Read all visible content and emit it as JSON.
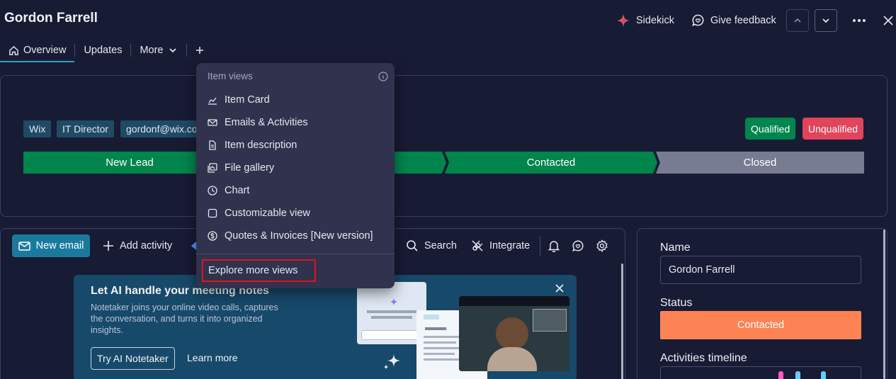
{
  "header": {
    "title": "Gordon Farrell",
    "sidekick_label": "Sidekick",
    "feedback_label": "Give feedback"
  },
  "tabs": [
    {
      "label": "Overview"
    },
    {
      "label": "Updates"
    },
    {
      "label": "More"
    }
  ],
  "tags": [
    "Wix",
    "IT Director",
    "gordonf@wix.co"
  ],
  "badges": {
    "qualified": "Qualified",
    "unqualified": "Unqualified"
  },
  "stages": [
    "New Lead",
    "Contacted",
    "Closed"
  ],
  "activity": {
    "new_email": "New email",
    "add_activity": "Add activity",
    "search": "Search",
    "integrate": "Integrate"
  },
  "banner": {
    "title": "Let AI handle your meeting notes",
    "description": "Notetaker joins your online video calls, captures the conversation, and turns it into organized insights.",
    "try_label": "Try AI Notetaker",
    "learn_label": "Learn more"
  },
  "details": {
    "name_label": "Name",
    "name_value": "Gordon Farrell",
    "status_label": "Status",
    "status_value": "Contacted",
    "timeline_label": "Activities timeline"
  },
  "menu": {
    "header": "Item views",
    "items": [
      {
        "label": "Item Card",
        "icon": "chart-card-icon"
      },
      {
        "label": "Emails & Activities",
        "icon": "mail-icon"
      },
      {
        "label": "Item description",
        "icon": "document-icon"
      },
      {
        "label": "File gallery",
        "icon": "gallery-icon"
      },
      {
        "label": "Chart",
        "icon": "clock-chart-icon"
      },
      {
        "label": "Customizable view",
        "icon": "square-icon"
      },
      {
        "label": "Quotes & Invoices [New version]",
        "icon": "dollar-icon"
      }
    ],
    "explore": "Explore more views"
  },
  "colors": {
    "background": "#181b34",
    "accent": "#1a7a9e",
    "stage_green": "#00854d",
    "stage_gray": "#787c92",
    "unqualified": "#e2445c",
    "status_orange": "#fd8355",
    "highlight_red": "#e0131f"
  }
}
